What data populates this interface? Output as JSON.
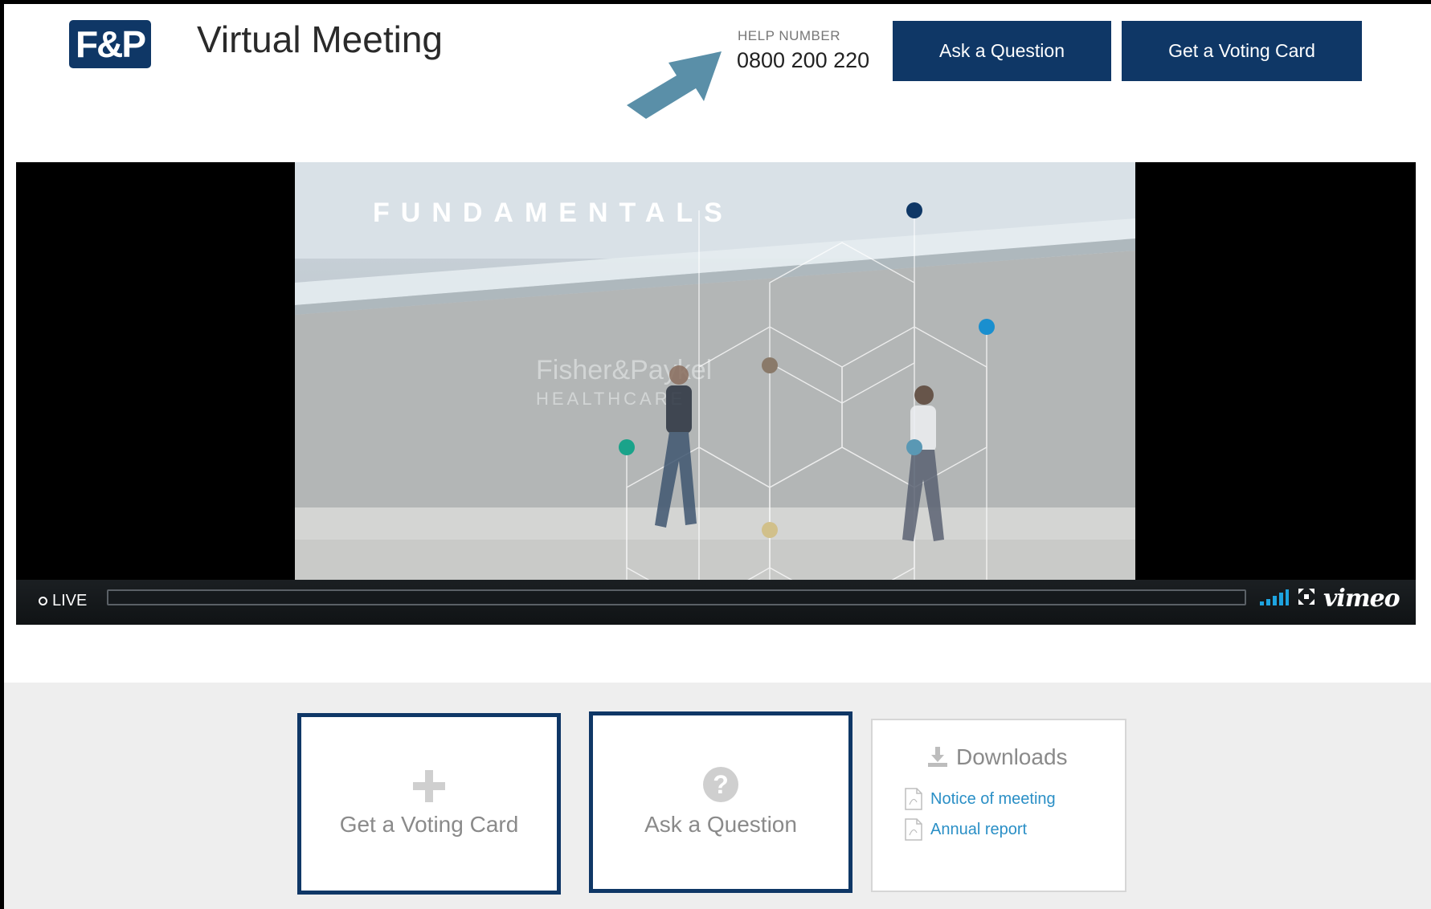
{
  "header": {
    "logo_text": "F&P",
    "title": "Virtual Meeting",
    "help_label": "HELP NUMBER",
    "help_number": "0800 200 220",
    "ask_button": "Ask a Question",
    "vote_button": "Get a Voting Card"
  },
  "video": {
    "overlay_title": "FUNDAMENTALS",
    "live_label": "LIVE",
    "brand": "vimeo"
  },
  "cards": {
    "vote_label": "Get a Voting Card",
    "ask_label": "Ask a Question",
    "vote_icon": "plus-icon",
    "ask_icon": "question-icon"
  },
  "downloads": {
    "title": "Downloads",
    "items": [
      {
        "label": "Notice of meeting",
        "icon": "pdf-icon"
      },
      {
        "label": "Annual report",
        "icon": "pdf-icon"
      }
    ]
  },
  "colors": {
    "brand_navy": "#0f3766",
    "link_blue": "#2a8fc6",
    "arrow": "#5a8fa8"
  }
}
